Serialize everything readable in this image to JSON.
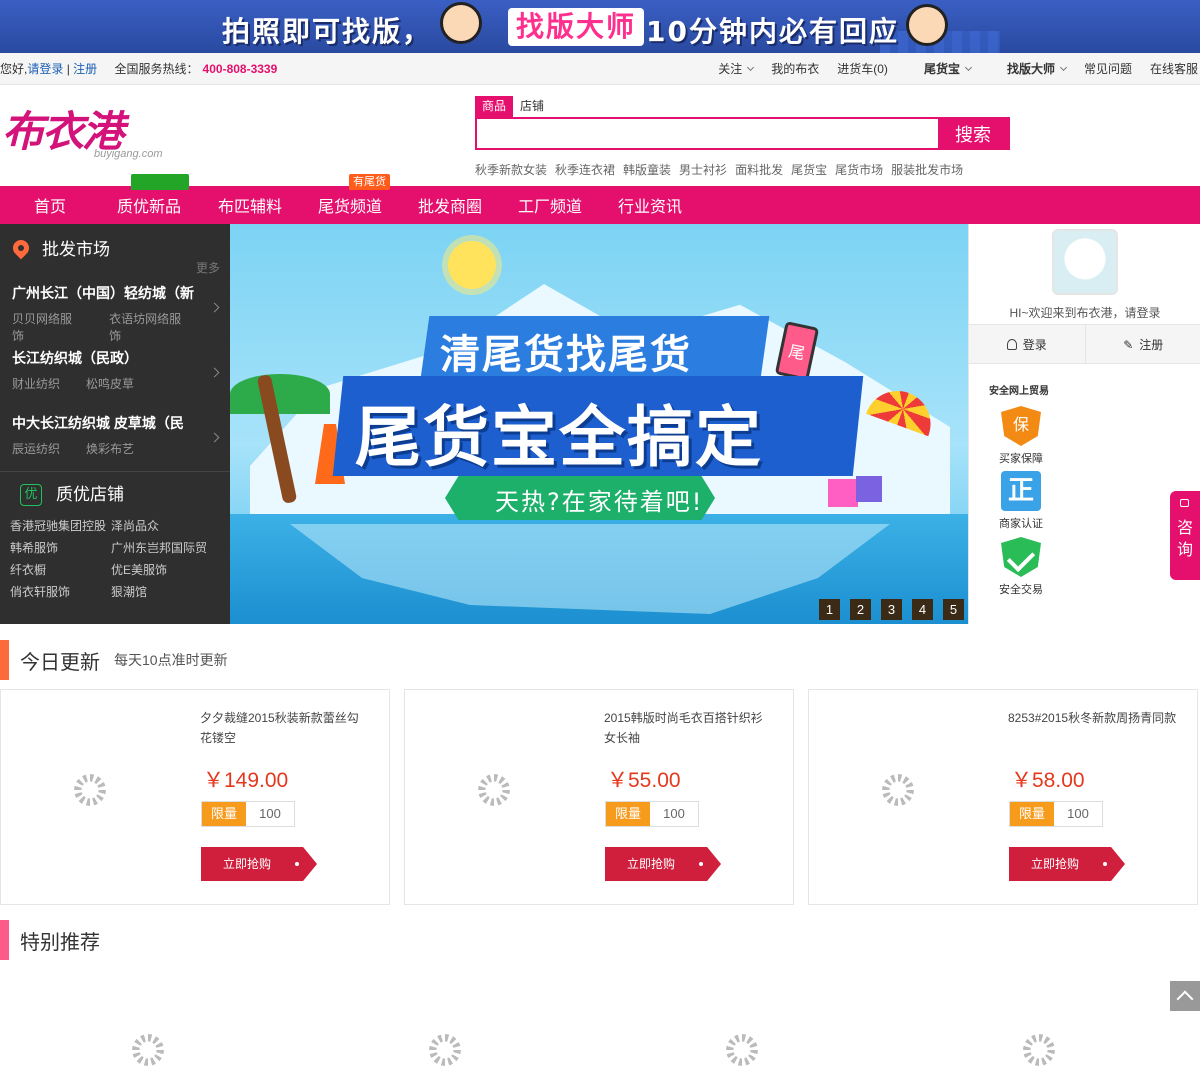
{
  "top_banner": {
    "part1": "拍照即可找版，",
    "part2": "找版大师",
    "part3": "10分钟内必有回应"
  },
  "util_bar": {
    "greeting": "您好,",
    "login": "请登录",
    "separator": "|",
    "register": "注册",
    "hotline_label": "全国服务热线：",
    "hotline": "400-808-3339",
    "right_items": [
      "关注",
      "我的布衣",
      "进货车(0)",
      "尾货宝",
      "找版大师",
      "常见问题",
      "在线客服"
    ]
  },
  "logo": {
    "cn": "布衣港",
    "en": "buyigang.com"
  },
  "search": {
    "tabs": [
      "商品",
      "店铺"
    ],
    "placeholder": "",
    "button": "搜索",
    "hot_words": [
      "秋季新款女装",
      "秋季连衣裙",
      "韩版童装",
      "男士衬衫",
      "面料批发",
      "尾货宝",
      "尾货市场",
      "服装批发市场"
    ]
  },
  "nav": {
    "items": [
      "首页",
      "质优新品",
      "布匹辅料",
      "尾货频道",
      "批发商圈",
      "工厂频道",
      "行业资讯"
    ],
    "badge_tail": "有尾货"
  },
  "sidebar": {
    "market_title": "批发市场",
    "more": "更多",
    "markets": [
      {
        "name": "广州长江（中国）轻纺城（新",
        "subs": [
          "贝贝网络服饰",
          "衣语坊网络服饰"
        ]
      },
      {
        "name": "长江纺织城（民政）",
        "subs": [
          "财业纺织",
          "松鸣皮草"
        ]
      },
      {
        "name": "中大长江纺织城 皮草城（民",
        "subs": [
          "辰运纺织",
          "焕彩布艺"
        ]
      }
    ],
    "shop_icon": "优",
    "shop_title": "质优店铺",
    "shops": [
      "香港冠驰集团控股",
      "泽尚品众",
      "韩希服饰",
      "广州东岂邦国际贸",
      "纤衣橱",
      "优E美服饰",
      "俏衣轩服饰",
      "狠潮馆"
    ]
  },
  "hero": {
    "title1": "清尾货找尾货",
    "title2": "尾货宝全搞定",
    "subtitle": "天热?在家待着吧!",
    "phone_char": "尾",
    "slides": [
      "1",
      "2",
      "3",
      "4",
      "5"
    ]
  },
  "user_panel": {
    "welcome": "HI~欢迎来到布衣港，请登录",
    "login": "登录",
    "register": "注册",
    "security_title": "安全网上贸易",
    "guarantee": "买家保障",
    "guarantee_char": "保",
    "verify": "商家认证",
    "verify_char": "正",
    "safe": "安全交易"
  },
  "consult": {
    "line1": "咨",
    "line2": "询"
  },
  "today": {
    "title": "今日更新",
    "subtitle": "每天10点准时更新",
    "products": [
      {
        "name": "夕夕裁缝2015秋装新款蕾丝勾花镂空",
        "price": "￥149.00",
        "limit_label": "限量",
        "limit": "100",
        "buy": "立即抢购"
      },
      {
        "name": "2015韩版时尚毛衣百搭针织衫女长袖",
        "price": "￥55.00",
        "limit_label": "限量",
        "limit": "100",
        "buy": "立即抢购"
      },
      {
        "name": "8253#2015秋冬新款周扬青同款",
        "price": "￥58.00",
        "limit_label": "限量",
        "limit": "100",
        "buy": "立即抢购"
      }
    ]
  },
  "special": {
    "title": "特别推荐"
  },
  "colors": {
    "brand": "#e5106d",
    "price": "#e5381c",
    "limit": "#f79b1c",
    "buy": "#d01e3d"
  }
}
